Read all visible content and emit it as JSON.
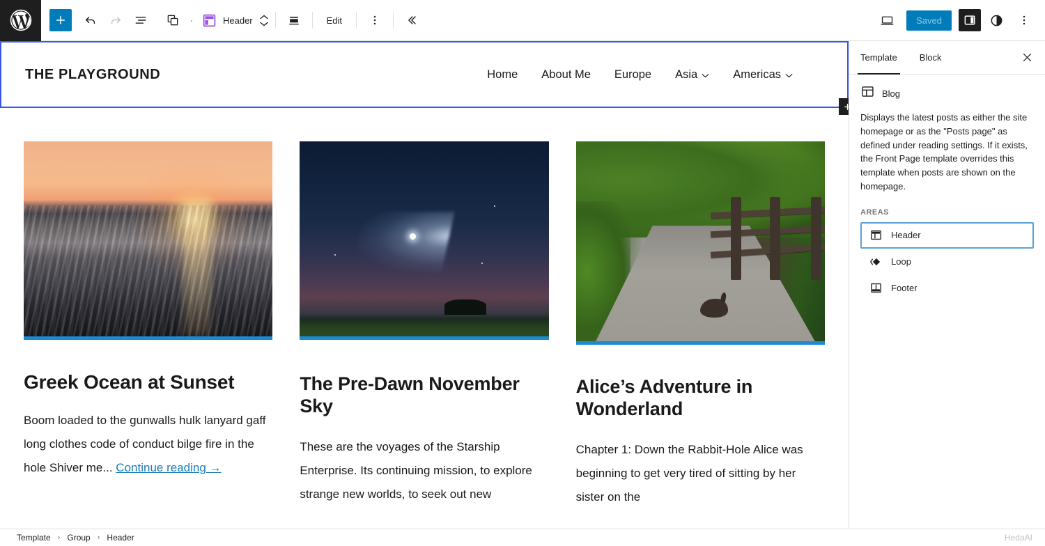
{
  "toolbar": {
    "wp_logo": "wordpress-logo",
    "add_label": "+",
    "block_name": "Header",
    "edit_label": "Edit",
    "save_label": "Saved",
    "dot": "·"
  },
  "sidebar": {
    "tabs": [
      {
        "label": "Template",
        "active": true
      },
      {
        "label": "Block",
        "active": false
      }
    ],
    "close_label": "✕",
    "template": {
      "title": "Blog",
      "description": "Displays the latest posts as either the site homepage or as the \"Posts page\" as defined under reading settings. If it exists, the Front Page template overrides this template when posts are shown on the homepage.",
      "areas_label": "Areas",
      "areas": [
        {
          "label": "Header",
          "icon": "header-area-icon",
          "selected": true
        },
        {
          "label": "Loop",
          "icon": "loop-area-icon",
          "selected": false
        },
        {
          "label": "Footer",
          "icon": "footer-area-icon",
          "selected": false
        }
      ]
    }
  },
  "site": {
    "title": "THE PLAYGROUND",
    "nav": [
      {
        "label": "Home",
        "has_submenu": false
      },
      {
        "label": "About Me",
        "has_submenu": false
      },
      {
        "label": "Europe",
        "has_submenu": false
      },
      {
        "label": "Asia",
        "has_submenu": true
      },
      {
        "label": "Americas",
        "has_submenu": true
      }
    ]
  },
  "posts": [
    {
      "title": "Greek Ocean at Sunset",
      "excerpt": "Boom loaded to the gunwalls hulk lanyard gaff long clothes code of conduct bilge fire in the hole Shiver me...",
      "continue_label": "Continue reading →",
      "image_alt": "sunset-over-ocean-waves"
    },
    {
      "title": "The Pre-Dawn November Sky",
      "excerpt": "These are the voyages of the Starship Enterprise. Its continuing mission, to explore strange new worlds, to seek out new",
      "continue_label": "",
      "image_alt": "rocket-plume-in-predawn-sky"
    },
    {
      "title": "Alice’s Adventure in Wonderland",
      "excerpt": "Chapter 1: Down the Rabbit-Hole Alice was beginning to get very tired of sitting by her sister on the",
      "continue_label": "",
      "image_alt": "rabbit-on-gravel-path"
    }
  ],
  "breadcrumb": {
    "items": [
      "Template",
      "Group",
      "Header"
    ],
    "separator": "›"
  },
  "watermark": "HedaAI",
  "colors": {
    "accent_blue": "#007cba",
    "selection_blue": "#3858e9",
    "image_border_blue": "#1b8ad4",
    "link_blue": "#1b7eb5",
    "block_icon_purple": "#9b51e0",
    "dark": "#1e1e1e"
  }
}
